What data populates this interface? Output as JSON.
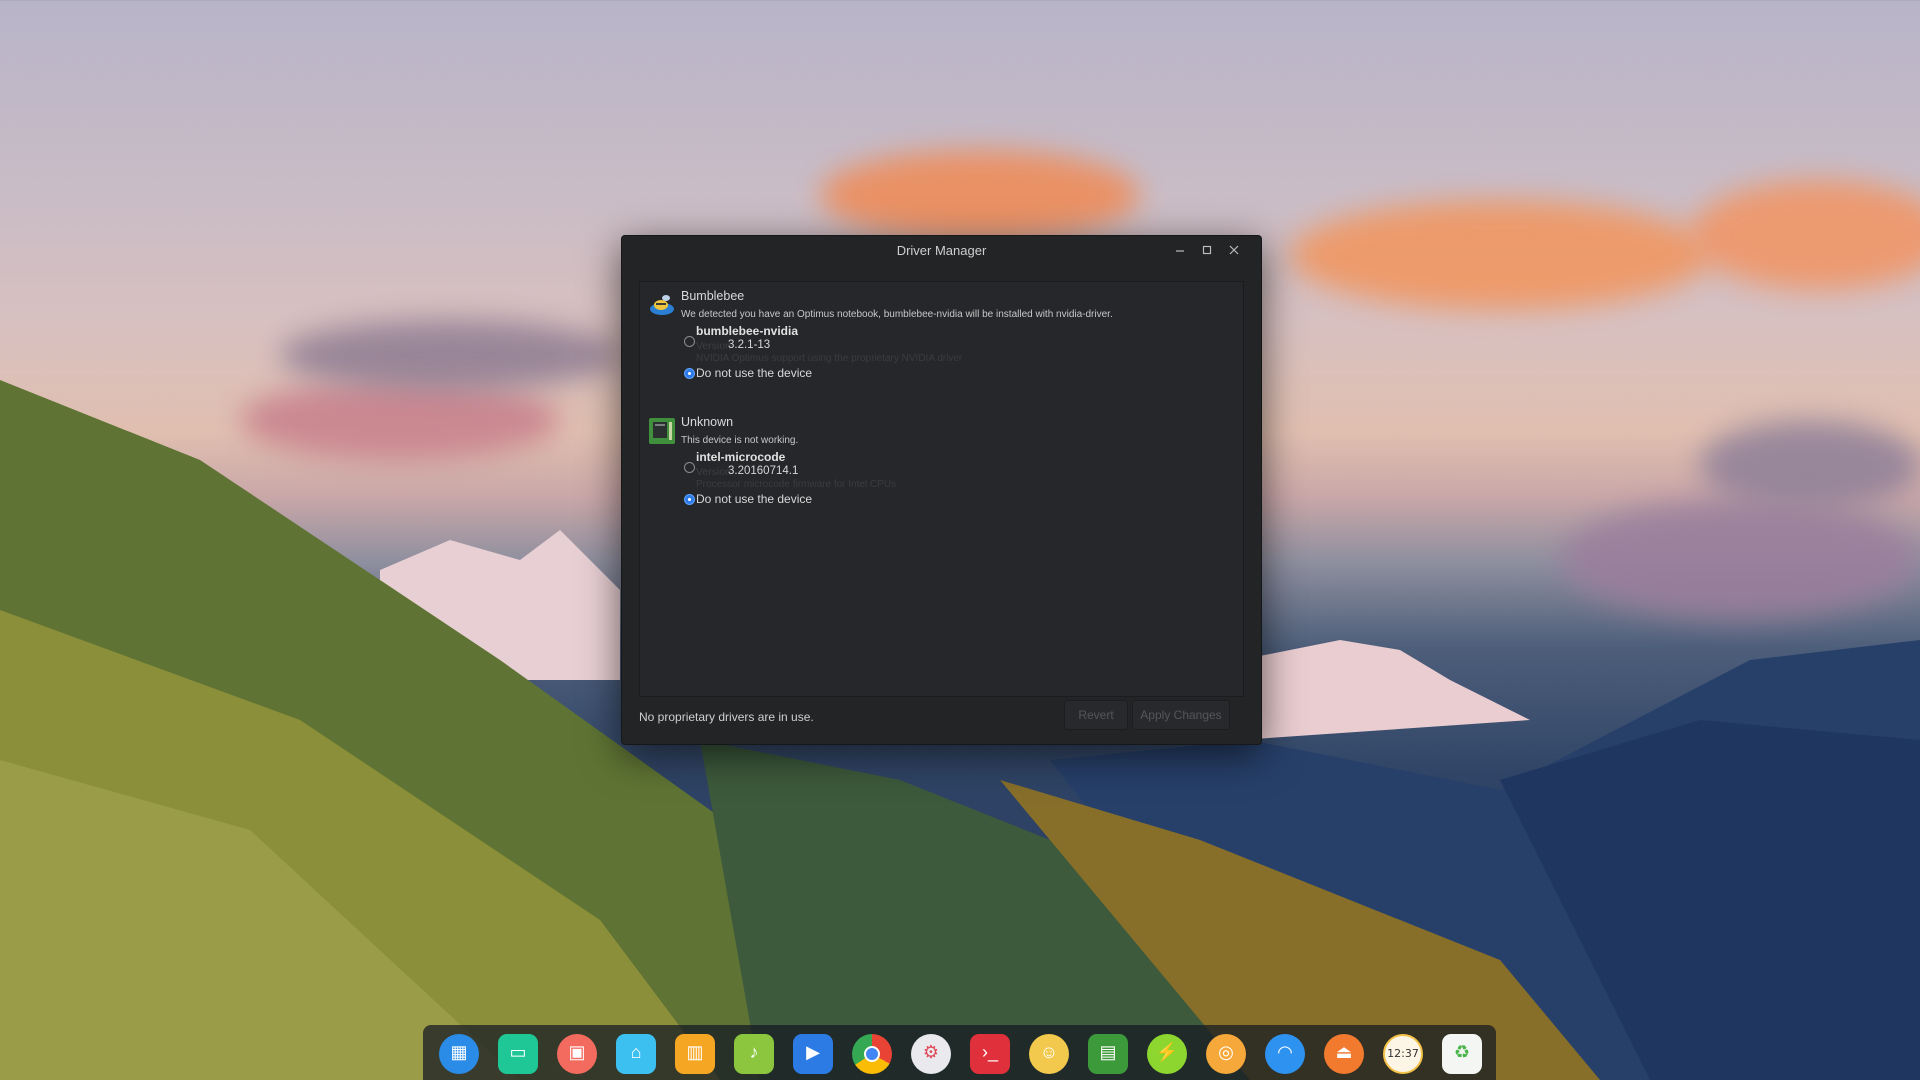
{
  "window": {
    "title": "Driver Manager"
  },
  "devices": [
    {
      "name": "Bumblebee",
      "description": "We detected you have an Optimus notebook, bumblebee-nvidia will be installed with nvidia-driver.",
      "driver": {
        "name": "bumblebee-nvidia",
        "version_label": "Version",
        "version": "3.2.1-13",
        "description": "NVIDIA Optimus support using the proprietary NVIDIA driver"
      },
      "none_option": "Do not use the device"
    },
    {
      "name": "Unknown",
      "description": "This device is not working.",
      "driver": {
        "name": "intel-microcode",
        "version_label": "Version",
        "version": "3.20160714.1",
        "description": "Processor microcode firmware for Intel CPUs"
      },
      "none_option": "Do not use the device"
    }
  ],
  "footer": {
    "status": "No proprietary drivers are in use.",
    "revert": "Revert",
    "apply": "Apply Changes"
  },
  "dock": {
    "clock_text": "12:37",
    "items": [
      "launcher-icon",
      "file-manager-icon",
      "screenshot-icon",
      "store-icon",
      "archive-icon",
      "music-icon",
      "video-icon",
      "chrome-icon",
      "settings-icon",
      "terminal-icon",
      "ailurus-icon",
      "system-monitor-icon",
      "power-icon",
      "browser-icon",
      "wifi-icon",
      "eject-icon",
      "clock-icon",
      "trash-icon"
    ]
  },
  "colors": {
    "window_bg": "#222426",
    "accent": "#2f7be8"
  }
}
